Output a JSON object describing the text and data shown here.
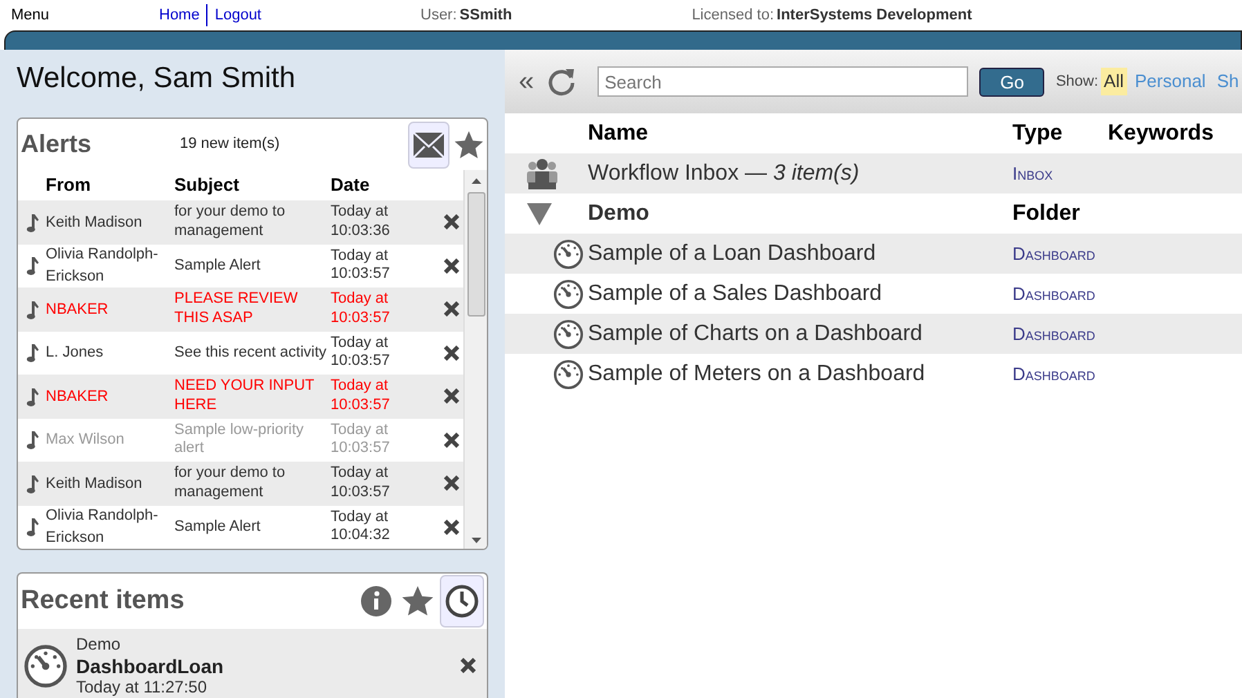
{
  "top_bar": {
    "menu": "Menu",
    "links": [
      "Home",
      "Logout"
    ],
    "user_label": "User:",
    "user": "SSmith",
    "license_label": "Licensed to:",
    "license": "InterSystems Development"
  },
  "welcome": "Welcome, Sam Smith",
  "alerts": {
    "title": "Alerts",
    "count": "19 new item(s)",
    "columns": [
      "From",
      "Subject",
      "Date"
    ],
    "rows": [
      {
        "from": "Keith Madison",
        "subject": "for your demo to management",
        "date": "Today at 10:03:36",
        "kind": "normal"
      },
      {
        "from": "Olivia Randolph-Erickson",
        "subject": "Sample Alert",
        "date": "Today at 10:03:57",
        "kind": "normal"
      },
      {
        "from": "NBAKER",
        "subject": "PLEASE REVIEW THIS ASAP",
        "date": "Today at 10:03:57",
        "kind": "high"
      },
      {
        "from": "L. Jones",
        "subject": "See this recent activity",
        "date": "Today at 10:03:57",
        "kind": "normal"
      },
      {
        "from": "NBAKER",
        "subject": "NEED YOUR INPUT HERE",
        "date": "Today at 10:03:57",
        "kind": "high"
      },
      {
        "from": "Max Wilson",
        "subject": "Sample low-priority alert",
        "date": "Today at 10:03:57",
        "kind": "low"
      },
      {
        "from": "Keith Madison",
        "subject": "for your demo to management",
        "date": "Today at 10:03:57",
        "kind": "normal"
      },
      {
        "from": "Olivia Randolph-Erickson",
        "subject": "Sample Alert",
        "date": "Today at 10:04:32",
        "kind": "normal"
      }
    ]
  },
  "recent": {
    "title": "Recent items",
    "items": [
      {
        "folder": "Demo",
        "name": "DashboardLoan",
        "time": "Today at 11:27:50"
      }
    ]
  },
  "toolbar": {
    "collapse": "«",
    "search_placeholder": "Search",
    "go": "Go",
    "show_label": "Show:",
    "show_options": [
      {
        "label": "All",
        "selected": true
      },
      {
        "label": "Personal",
        "selected": false
      },
      {
        "label": "Sh",
        "selected": false
      }
    ]
  },
  "table": {
    "columns": [
      "Name",
      "Type",
      "Keywords"
    ],
    "rows": [
      {
        "kind": "inbox",
        "name": "Workflow Inbox — *3 item(s)*",
        "type": "Inbox"
      },
      {
        "kind": "folder",
        "name": "Demo",
        "type": "Folder",
        "expanded": true
      },
      {
        "kind": "dashboard",
        "name": "Sample of a Loan Dashboard",
        "type": "Dashboard"
      },
      {
        "kind": "dashboard",
        "name": "Sample of a Sales Dashboard",
        "type": "Dashboard"
      },
      {
        "kind": "dashboard",
        "name": "Sample of Charts on a Dashboard",
        "type": "Dashboard"
      },
      {
        "kind": "dashboard",
        "name": "Sample of Meters on a Dashboard",
        "type": "Dashboard"
      }
    ]
  }
}
